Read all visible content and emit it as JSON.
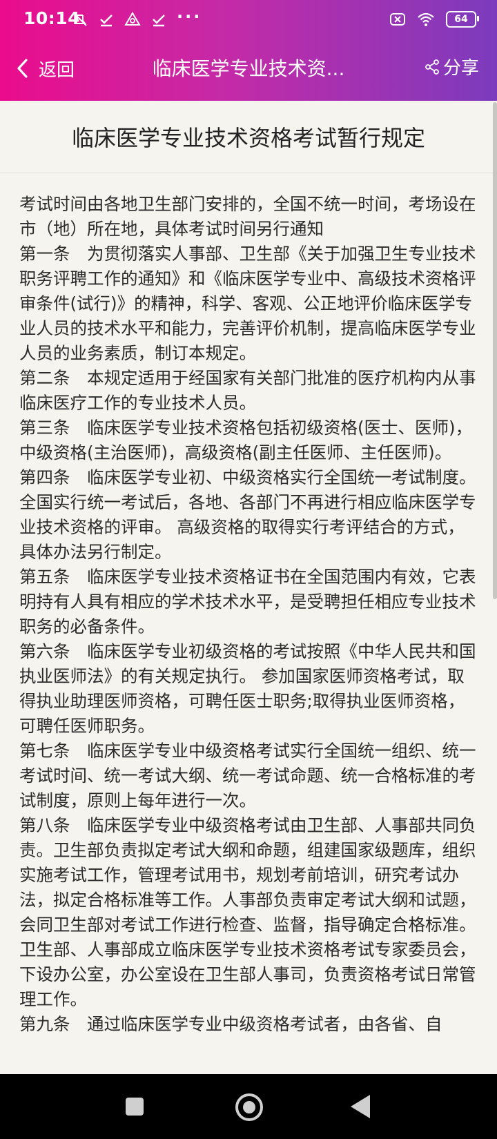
{
  "status_bar": {
    "time": "10:14",
    "battery": "64",
    "left_icons": [
      "mute-icon",
      "download-check-icon",
      "alert-triangle-icon",
      "download-check-icon",
      "more-dots-icon"
    ],
    "right_icons": [
      "sim-off-icon",
      "wifi-icon",
      "battery-icon"
    ]
  },
  "nav": {
    "back_label": "返回",
    "title": "临床医学专业技术资...",
    "share_label": "分享"
  },
  "document": {
    "heading": "临床医学专业技术资格考试暂行规定",
    "paragraphs": [
      "考试时间由各地卫生部门安排的，全国不统一时间，考场设在市（地）所在地，具体考试时间另行通知",
      "第一条　为贯彻落实人事部、卫生部《关于加强卫生专业技术职务评聘工作的通知》和《临床医学专业中、高级技术资格评审条件(试行)》的精神，科学、客观、公正地评价临床医学专业人员的技术水平和能力，完善评价机制，提高临床医学专业人员的业务素质，制订本规定。",
      "第二条　本规定适用于经国家有关部门批准的医疗机构内从事临床医疗工作的专业技术人员。",
      "第三条　临床医学专业技术资格包括初级资格(医士、医师)，中级资格(主治医师)，高级资格(副主任医师、主任医师)。",
      "第四条　临床医学专业初、中级资格实行全国统一考试制度。全国实行统一考试后，各地、各部门不再进行相应临床医学专业技术资格的评审。 高级资格的取得实行考评结合的方式，具体办法另行制定。",
      "第五条　临床医学专业技术资格证书在全国范围内有效，它表明持有人具有相应的学术技术水平，是受聘担任相应专业技术职务的必备条件。",
      "第六条　临床医学专业初级资格的考试按照《中华人民共和国执业医师法》的有关规定执行。 参加国家医师资格考试，取得执业助理医师资格，可聘任医士职务;取得执业医师资格，可聘任医师职务。",
      "第七条　临床医学专业中级资格考试实行全国统一组织、统一考试时间、统一考试大纲、统一考试命题、统一合格标准的考试制度，原则上每年进行一次。",
      "第八条　临床医学专业中级资格考试由卫生部、人事部共同负责。卫生部负责拟定考试大纲和命题，组建国家级题库，组织实施考试工作，管理考试用书，规划考前培训，研究考试办法，拟定合格标准等工作。人事部负责审定考试大纲和试题，会同卫生部对考试工作进行检查、监督，指导确定合格标准。 卫生部、人事部成立临床医学专业技术资格考试专家委员会，下设办公室，办公室设在卫生部人事司，负责资格考试日常管理工作。",
      "第九条　通过临床医学专业中级资格考试者，由各省、自"
    ]
  },
  "system_nav": {
    "icons": [
      "recents-square-icon",
      "home-circle-icon",
      "back-triangle-icon"
    ]
  }
}
